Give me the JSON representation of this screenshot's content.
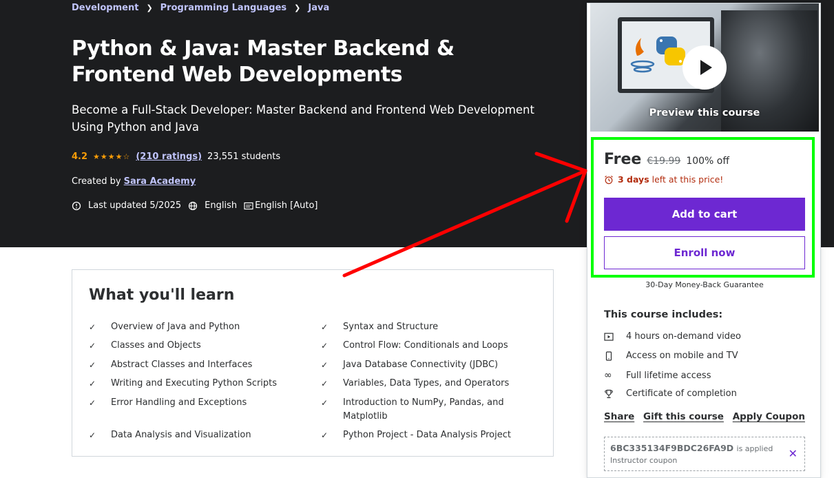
{
  "breadcrumb": [
    {
      "label": "Development"
    },
    {
      "label": "Programming Languages"
    },
    {
      "label": "Java"
    }
  ],
  "course": {
    "title": "Python & Java: Master Backend & Frontend Web Developments",
    "subtitle": "Become a Full-Stack Developer: Master Backend and Frontend Web Development Using Python and Java",
    "rating": "4.2",
    "stars": 4.2,
    "ratings_count": "(210 ratings)",
    "students": "23,551 students",
    "created_by_label": "Created by",
    "author": "Sara Academy",
    "last_updated": "Last updated 5/2025",
    "language": "English",
    "captions": "English [Auto]"
  },
  "learn": {
    "title": "What you'll learn",
    "items_left": [
      "Overview of Java and Python",
      "Classes and Objects",
      "Abstract Classes and Interfaces",
      "Writing and Executing Python Scripts",
      "Error Handling and Exceptions",
      "Data Analysis and Visualization"
    ],
    "items_right": [
      "Syntax and Structure",
      "Control Flow: Conditionals and Loops",
      "Java Database Connectivity (JDBC)",
      "Variables, Data Types, and Operators",
      "Introduction to NumPy, Pandas, and Matplotlib",
      "Python Project - Data Analysis Project"
    ]
  },
  "sidebar": {
    "preview_label": "Preview this course",
    "price": "Free",
    "original_price": "€19.99",
    "discount": "100% off",
    "timer_bold": "3 days",
    "timer_rest": "left at this price!",
    "add_to_cart": "Add to cart",
    "enroll_now": "Enroll now",
    "guarantee": "30-Day Money-Back Guarantee",
    "includes_title": "This course includes:",
    "includes": [
      {
        "icon": "video-icon",
        "label": "4 hours on-demand video"
      },
      {
        "icon": "mobile-icon",
        "label": "Access on mobile and TV"
      },
      {
        "icon": "infinity-icon",
        "label": "Full lifetime access"
      },
      {
        "icon": "trophy-icon",
        "label": "Certificate of completion"
      }
    ],
    "links": {
      "share": "Share",
      "gift": "Gift this course",
      "coupon": "Apply Coupon"
    },
    "coupon_code": "6BC335134F9BDC26FA9D",
    "coupon_applied": "is applied",
    "coupon_label": "Instructor coupon"
  },
  "colors": {
    "hero_bg": "#1c1d1f",
    "accent_purple": "#6d28d2",
    "link_lavender": "#c0c4fc",
    "star_orange": "#f69c08",
    "timer_red": "#b32d0f",
    "annotation_green": "#00ff00",
    "annotation_red": "#ff0000"
  }
}
